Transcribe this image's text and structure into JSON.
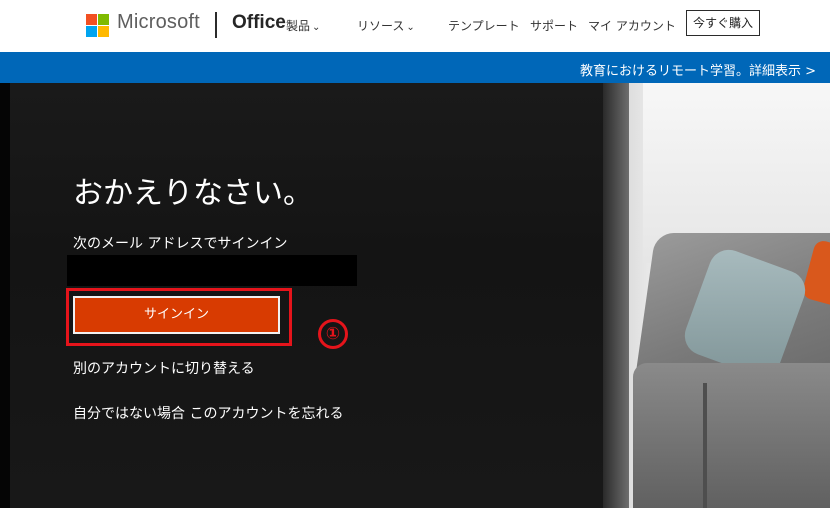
{
  "header": {
    "brand": "Microsoft",
    "product": "Office",
    "nav": [
      {
        "label": "製品",
        "has_dropdown": true
      },
      {
        "label": "リソース",
        "has_dropdown": true
      },
      {
        "label": "テンプレート",
        "has_dropdown": false
      },
      {
        "label": "サポート",
        "has_dropdown": false
      },
      {
        "label": "マイ アカウント",
        "has_dropdown": false
      }
    ],
    "buy_button": "今すぐ購入",
    "chevron": "⌄"
  },
  "banner": {
    "text": "教育におけるリモート学習。詳細表示 >"
  },
  "signin": {
    "welcome": "おかえりなさい。",
    "signin_with": "次のメール アドレスでサインイン",
    "signin_button": "サインイン",
    "step_marker": "①",
    "switch_account": "別のアカウントに切り替える",
    "forget_account": "自分ではない場合 このアカウントを忘れる"
  },
  "colors": {
    "banner": "#0067b8",
    "signin_button": "#d83b01",
    "annotation": "#e5141b"
  }
}
